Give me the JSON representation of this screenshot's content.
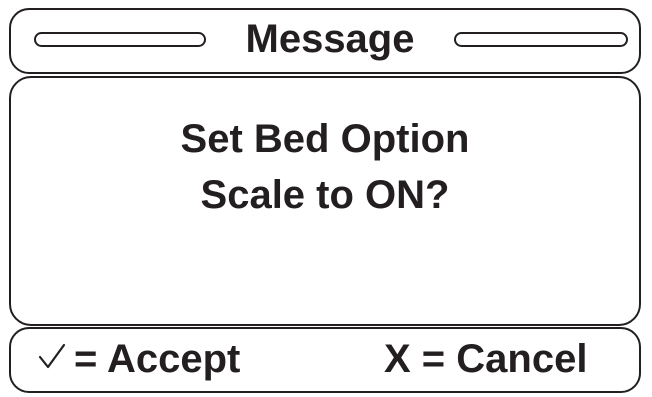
{
  "dialog": {
    "title": "Message",
    "message_lines": [
      "Set Bed Option",
      "Scale to ON?"
    ]
  },
  "footer": {
    "accept_icon": "checkmark-icon",
    "accept_label": "= Accept",
    "cancel_label": "X = Cancel"
  },
  "colors": {
    "ink": "#231f20",
    "background": "#ffffff"
  }
}
